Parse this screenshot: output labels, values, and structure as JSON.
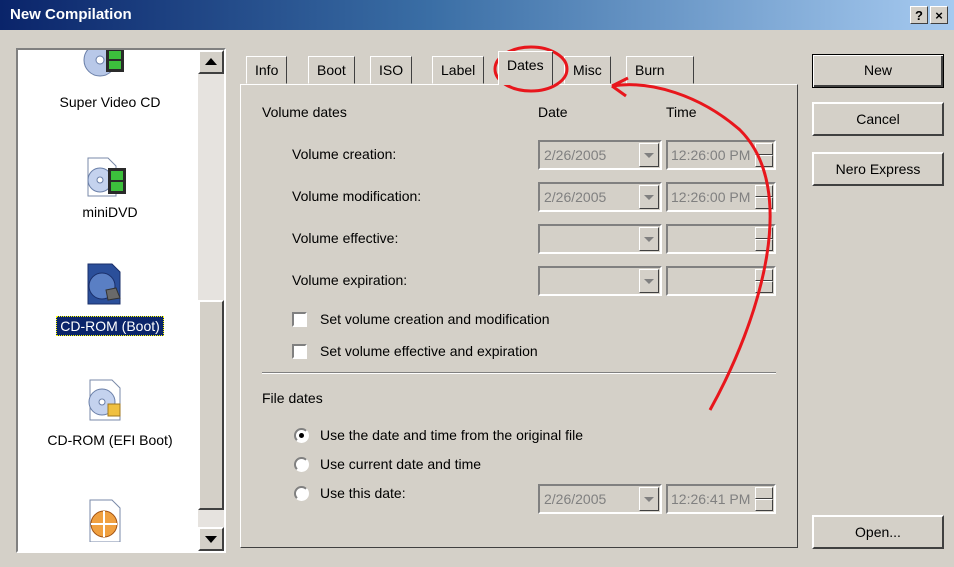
{
  "window": {
    "title": "New Compilation",
    "help_button": "?",
    "close_button": "×"
  },
  "left_list": {
    "items": [
      {
        "label": "Super Video CD",
        "icon": "video-cd-icon"
      },
      {
        "label": "miniDVD",
        "icon": "dvd-film-icon"
      },
      {
        "label": "CD-ROM (Boot)",
        "icon": "boot-cd-icon",
        "selected": true
      },
      {
        "label": "CD-ROM (EFI Boot)",
        "icon": "efi-boot-cd-icon"
      }
    ]
  },
  "tabs": [
    {
      "label": "Info"
    },
    {
      "label": "Boot"
    },
    {
      "label": "ISO"
    },
    {
      "label": "Label"
    },
    {
      "label": "Dates",
      "active": true
    },
    {
      "label": "Misc"
    },
    {
      "label": "Burn"
    }
  ],
  "volume_dates": {
    "heading": "Volume dates",
    "date_col": "Date",
    "time_col": "Time",
    "rows": [
      {
        "label": "Volume creation:",
        "date": "2/26/2005",
        "time": "12:26:00 PM"
      },
      {
        "label": "Volume modification:",
        "date": "2/26/2005",
        "time": "12:26:00 PM"
      },
      {
        "label": "Volume effective:",
        "date": "",
        "time": ""
      },
      {
        "label": "Volume expiration:",
        "date": "",
        "time": ""
      }
    ],
    "check_set_creation": "Set volume creation and modification",
    "check_set_effective": "Set volume effective and expiration"
  },
  "file_dates": {
    "heading": "File dates",
    "opt_original": "Use the date and time from the original file",
    "opt_current": "Use current date and time",
    "opt_this": "Use this date:",
    "date": "2/26/2005",
    "time": "12:26:41 PM"
  },
  "buttons": {
    "new": "New",
    "cancel": "Cancel",
    "nero_express": "Nero Express",
    "open": "Open..."
  },
  "colors": {
    "annotation": "#e8161c",
    "selection": "#0a246a"
  }
}
